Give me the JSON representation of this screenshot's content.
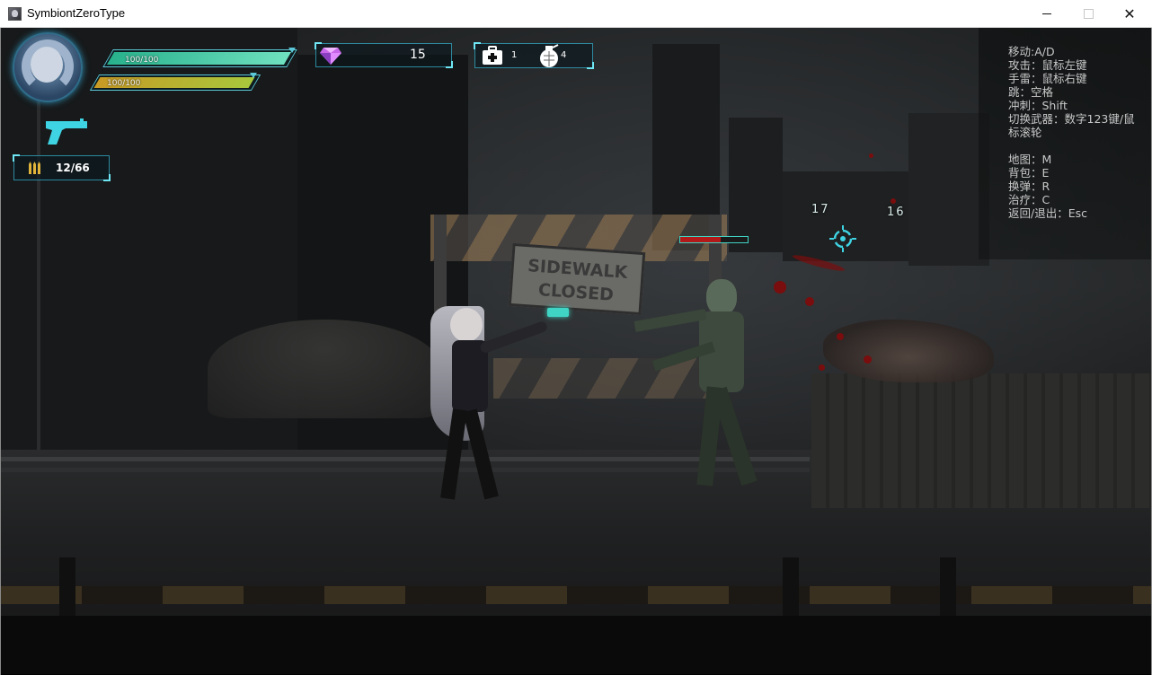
{
  "window": {
    "title": "SymbiontZeroType",
    "controls": {
      "minimize": "minimize",
      "maximize": "maximize",
      "close": "✕"
    }
  },
  "hud": {
    "hp": {
      "text": "100/100",
      "fraction": 1.0,
      "color": "#3fd1a8"
    },
    "energy": {
      "text": "100/100",
      "fraction": 1.0,
      "color": "#b8b02e"
    },
    "gems": {
      "value": "15",
      "icon": "diamond-icon"
    },
    "medkits": {
      "value": "1",
      "icon": "medkit-icon"
    },
    "grenades": {
      "value": "4",
      "icon": "grenade-icon"
    },
    "weapon": {
      "icon": "pistol-icon",
      "color": "#3fd4e4"
    },
    "ammo": {
      "value": "12/66",
      "icon": "bullets-icon"
    },
    "accent": "#5bc8d8"
  },
  "scene": {
    "sign_line1": "SIDEWALK",
    "sign_line2": "CLOSED",
    "damage_numbers": [
      "17",
      "16"
    ],
    "enemy_hp_fraction": 0.6,
    "enemy_hp_color": "#b21a1a"
  },
  "controls_help": [
    "移动:A/D",
    "攻击：鼠标左键",
    "手雷：鼠标右键",
    "跳：空格",
    "冲刺：Shift",
    "切换武器：数字123键/鼠",
    "标滚轮",
    "",
    "地图：M",
    "背包：E",
    "换弹：R",
    "治疗：C",
    "返回/退出：Esc"
  ]
}
